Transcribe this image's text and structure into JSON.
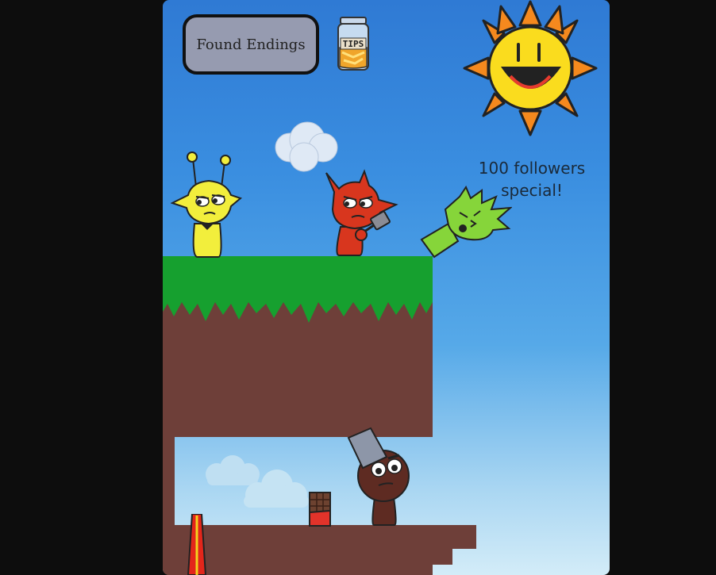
{
  "menu": {
    "found_endings_label": "Found Endings",
    "tips_label": "TIPS"
  },
  "banner": {
    "line1": "100 followers",
    "line2": "special!"
  },
  "colors": {
    "sky_top": "#2f7ad4",
    "sky_bottom": "#d3ecf8",
    "grass": "#16a02f",
    "dirt": "#6e3f39",
    "button_bg": "#969bb0",
    "sun": "#fadc1e",
    "sun_rays": "#f5891e"
  },
  "characters": [
    {
      "name": "yellow-antenna-character",
      "color": "#f2ee3c"
    },
    {
      "name": "red-horned-character",
      "color": "#d8361e"
    },
    {
      "name": "green-spiky-character",
      "color": "#86d53a"
    },
    {
      "name": "brown-bucket-character",
      "color": "#5e2b22"
    }
  ]
}
